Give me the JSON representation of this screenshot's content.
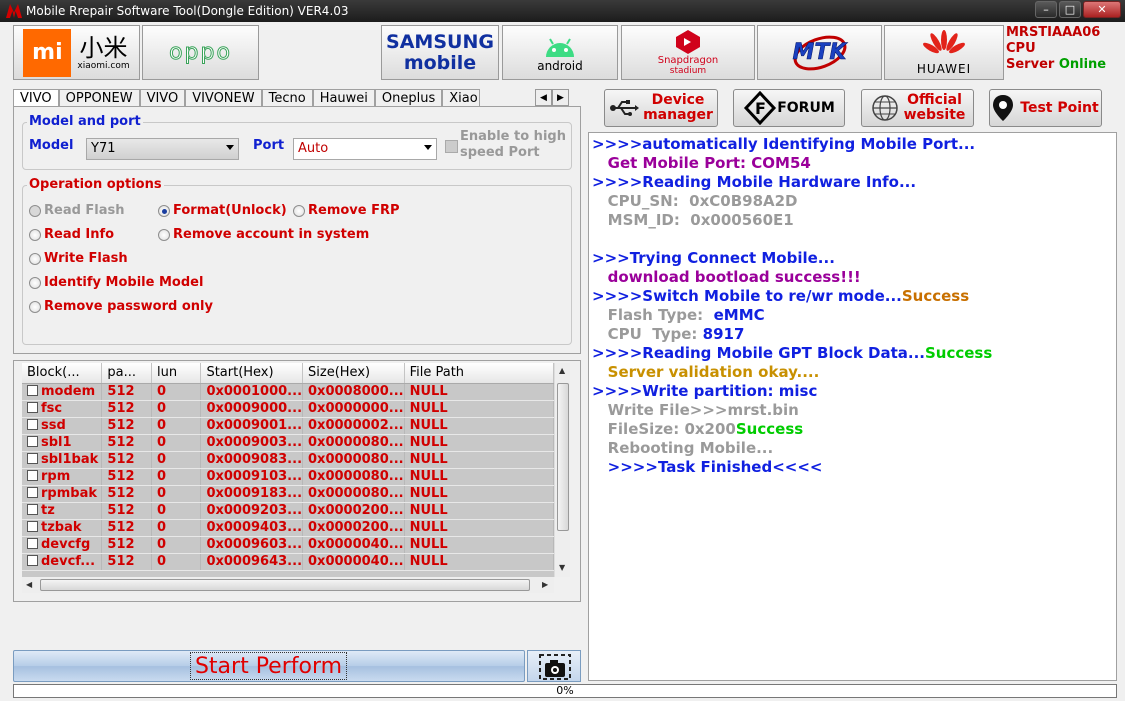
{
  "window": {
    "title": "Mobile Rrepair Software Tool(Dongle Edition) VER4.03"
  },
  "brands": {
    "xiaomi": {
      "cn": "小米",
      "sub": "xiaomi.com",
      "logo_text": "mi"
    },
    "oppo": "oppo",
    "samsung": {
      "line1": "SAMSUNG",
      "line2": "mobile"
    },
    "android": "android",
    "snapdragon": {
      "line1": "Snapdragon",
      "line2": "stadium"
    },
    "mtk": "MTK",
    "huawei": "HUAWEI"
  },
  "status": {
    "id": "MRSTIAAA06",
    "cpu": "CPU",
    "server_label": "Server",
    "server_state": "Online"
  },
  "tabs": [
    "VIVO",
    "OPPONEW",
    "VIVO",
    "VIVONEW",
    "Tecno",
    "Hauwei",
    "Oneplus",
    "Xiao"
  ],
  "model_port": {
    "title": "Model and port",
    "model_label": "Model",
    "model_value": "Y71",
    "port_label": "Port",
    "port_value": "Auto",
    "high_speed_label": "Enable to high speed Port",
    "high_speed_line1": "Enable to high",
    "high_speed_line2": "speed Port"
  },
  "operations": {
    "title": "Operation options",
    "read_flash": "Read Flash",
    "format_unlock": "Format(Unlock)",
    "remove_frp": "Remove FRP",
    "read_info": "Read Info",
    "remove_account": "Remove account in system",
    "write_flash": "Write Flash",
    "identify_model": "Identify Mobile Model",
    "remove_password": "Remove password only",
    "selected": "format_unlock"
  },
  "table": {
    "headers": [
      "Block(...",
      "pa...",
      "lun",
      "Start(Hex)",
      "Size(Hex)",
      "File Path"
    ],
    "rows": [
      [
        "modem",
        "512",
        "0",
        "0x0001000...",
        "0x0008000...",
        "NULL"
      ],
      [
        "fsc",
        "512",
        "0",
        "0x0009000...",
        "0x0000000...",
        "NULL"
      ],
      [
        "ssd",
        "512",
        "0",
        "0x0009001...",
        "0x0000002...",
        "NULL"
      ],
      [
        "sbl1",
        "512",
        "0",
        "0x0009003...",
        "0x0000080...",
        "NULL"
      ],
      [
        "sbl1bak",
        "512",
        "0",
        "0x0009083...",
        "0x0000080...",
        "NULL"
      ],
      [
        "rpm",
        "512",
        "0",
        "0x0009103...",
        "0x0000080...",
        "NULL"
      ],
      [
        "rpmbak",
        "512",
        "0",
        "0x0009183...",
        "0x0000080...",
        "NULL"
      ],
      [
        "tz",
        "512",
        "0",
        "0x0009203...",
        "0x0000200...",
        "NULL"
      ],
      [
        "tzbak",
        "512",
        "0",
        "0x0009403...",
        "0x0000200...",
        "NULL"
      ],
      [
        "devcfg",
        "512",
        "0",
        "0x0009603...",
        "0x0000040...",
        "NULL"
      ],
      [
        "devcf...",
        "512",
        "0",
        "0x0009643...",
        "0x0000040...",
        "NULL"
      ]
    ]
  },
  "actions": {
    "start": "Start Perform",
    "device_manager": "Device manager",
    "dm1": "Device",
    "dm2": "manager",
    "forum": "FORUM",
    "official_website": "Official website",
    "ow1": "Official",
    "ow2": "website",
    "test_point": "Test Point"
  },
  "progress": {
    "value": 0,
    "text": "0%"
  },
  "log": [
    {
      "text": ">>>>automatically Identifying Mobile Port...",
      "color": "#1020e0"
    },
    {
      "text": "   Get Mobile Port: COM54",
      "color": "#9a009a"
    },
    {
      "text": ">>>>Reading Mobile Hardware Info...",
      "color": "#1020e0"
    },
    {
      "text": "   CPU_SN:  0xC0B98A2D",
      "color": "#9a9a9a"
    },
    {
      "text": "   MSM_ID:  0x000560E1",
      "color": "#9a9a9a"
    },
    {
      "text": "",
      "color": "#000000"
    },
    {
      "text": ">>>Trying Connect Mobile...",
      "color": "#1020e0"
    },
    {
      "text": "   download bootload success!!!",
      "color": "#9a009a"
    },
    {
      "text": ">>>>Switch Mobile to re/wr mode...",
      "color": "#1020e0",
      "suffix": "Success",
      "suffix_color": "#c87000"
    },
    {
      "text": "   Flash Type:  ",
      "color": "#9a9a9a",
      "suffix": "eMMC",
      "suffix_color": "#1020e0"
    },
    {
      "text": "   CPU  Type: ",
      "color": "#9a9a9a",
      "suffix": "8917",
      "suffix_color": "#1020e0"
    },
    {
      "text": ">>>>Reading Mobile GPT Block Data...",
      "color": "#1020e0",
      "suffix": "Success",
      "suffix_color": "#00cc00"
    },
    {
      "text": "   Server validation okay....",
      "color": "#c89000"
    },
    {
      "text": ">>>>Write partition: misc",
      "color": "#1020e0"
    },
    {
      "text": "   Write File>>>mrst.bin",
      "color": "#9a9a9a"
    },
    {
      "text": "   FileSize: 0x200",
      "color": "#9a9a9a",
      "suffix": "Success",
      "suffix_color": "#00cc00"
    },
    {
      "text": "   Rebooting Mobile...",
      "color": "#9a9a9a"
    },
    {
      "text": "   >>>>Task Finished<<<<",
      "color": "#1020e0"
    }
  ]
}
